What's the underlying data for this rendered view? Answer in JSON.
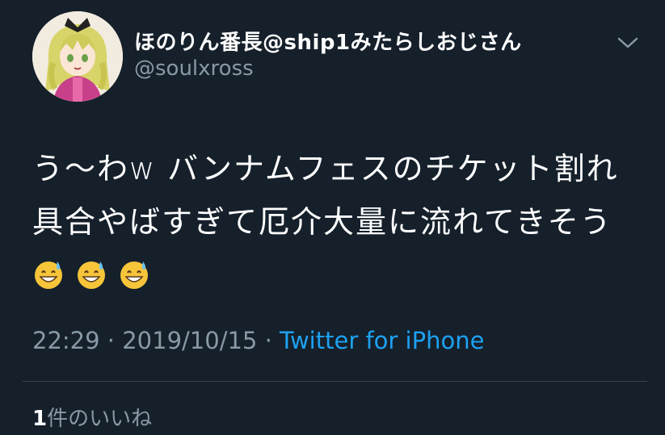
{
  "tweet": {
    "display_name": "ほのりん番長@ship1みたらしおじさん",
    "handle": "@soulxross",
    "text": "う〜わw バンナムフェスのチケット割れ具合やばすぎて厄介大量に流れてきそう",
    "emojis": [
      "grinning-face-with-sweat",
      "grinning-face-with-sweat",
      "grinning-face-with-sweat"
    ],
    "time": "22:29",
    "date": "2019/10/15",
    "separator": "·",
    "source": "Twitter for iPhone",
    "like_count": "1",
    "like_label": "件のいいね"
  },
  "colors": {
    "background": "#15202b",
    "secondary_text": "#8899a6",
    "link": "#1da1f2",
    "divider": "#38444d"
  }
}
